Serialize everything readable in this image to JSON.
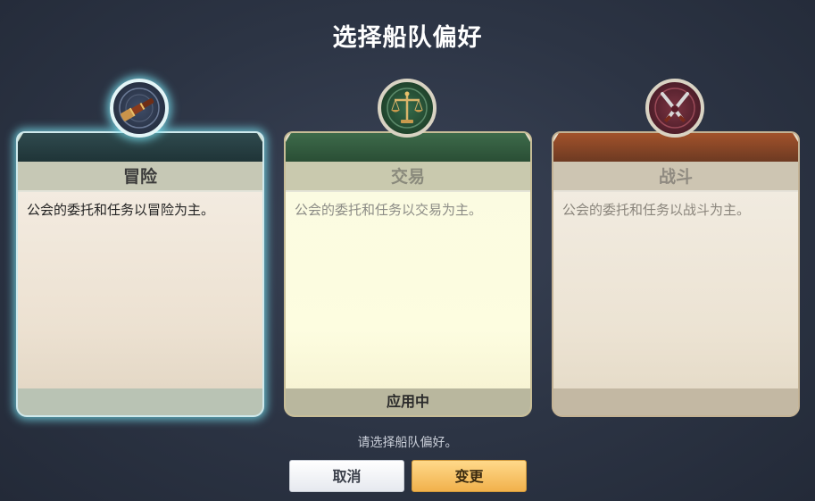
{
  "title": "选择船队偏好",
  "cards": [
    {
      "id": "adventure",
      "name": "冒险",
      "description": "公会的委托和任务以冒险为主。",
      "footer": "",
      "selected": true,
      "icon": "spyglass-icon",
      "accent": "#7ee3f0"
    },
    {
      "id": "trade",
      "name": "交易",
      "description": "公会的委托和任务以交易为主。",
      "footer": "应用中",
      "selected": false,
      "icon": "scales-icon",
      "accent": "#3d6a4a"
    },
    {
      "id": "battle",
      "name": "战斗",
      "description": "公会的委托和任务以战斗为主。",
      "footer": "",
      "selected": false,
      "icon": "crossed-swords-icon",
      "accent": "#a2522b"
    }
  ],
  "hint": "请选择船队偏好。",
  "buttons": {
    "cancel": "取消",
    "change": "变更"
  }
}
